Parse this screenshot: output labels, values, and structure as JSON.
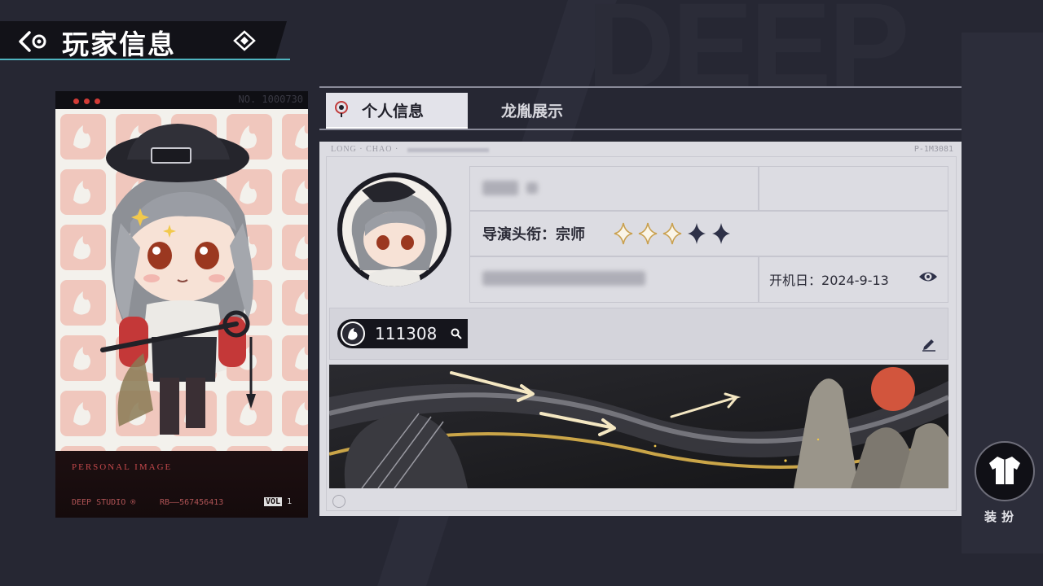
{
  "header": {
    "title": "玩家信息"
  },
  "card": {
    "number": "NO. 1000730",
    "footer_title": "PERSONAL IMAGE",
    "studio": "DEEP STUDIO ®",
    "rb": "RB——567456413",
    "vol_label": "VOL",
    "vol_number": "1"
  },
  "tabs": [
    {
      "label": "个人信息",
      "active": true
    },
    {
      "label": "龙胤展示",
      "active": false
    }
  ],
  "profile": {
    "panel_header": "LONG · CHAO ·",
    "serial": "P-1M3081",
    "rank_label": "导演头衔：",
    "rank_value": "宗师",
    "stars": {
      "filled_gold": 3,
      "filled_dark": 2,
      "total": 5
    },
    "start_label": "开机日：",
    "start_date": "2024-9-13",
    "player_id": "111308"
  },
  "side_button": {
    "label": "装扮",
    "icon": "outfit-jacket-icon"
  },
  "colors": {
    "accent": "#4fb4bf",
    "background": "#262733",
    "card_red": "#c3484b",
    "gold": "#d4ad5a"
  }
}
